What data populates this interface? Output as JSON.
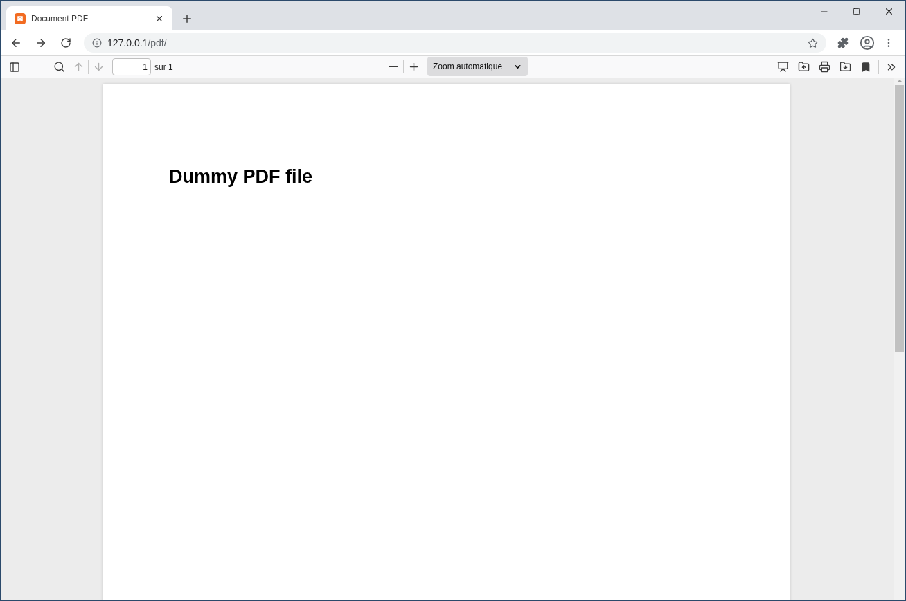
{
  "tabs": [
    {
      "title": "Document PDF",
      "selected": true
    }
  ],
  "address_bar": {
    "host": "127.0.0.1",
    "path": "/pdf/"
  },
  "pdf_toolbar": {
    "previous_disabled": true,
    "next_disabled": true,
    "page_number": "1",
    "page_count": "sur 1",
    "zoom": "Zoom automatique"
  },
  "document": {
    "heading": "Dummy PDF file"
  }
}
